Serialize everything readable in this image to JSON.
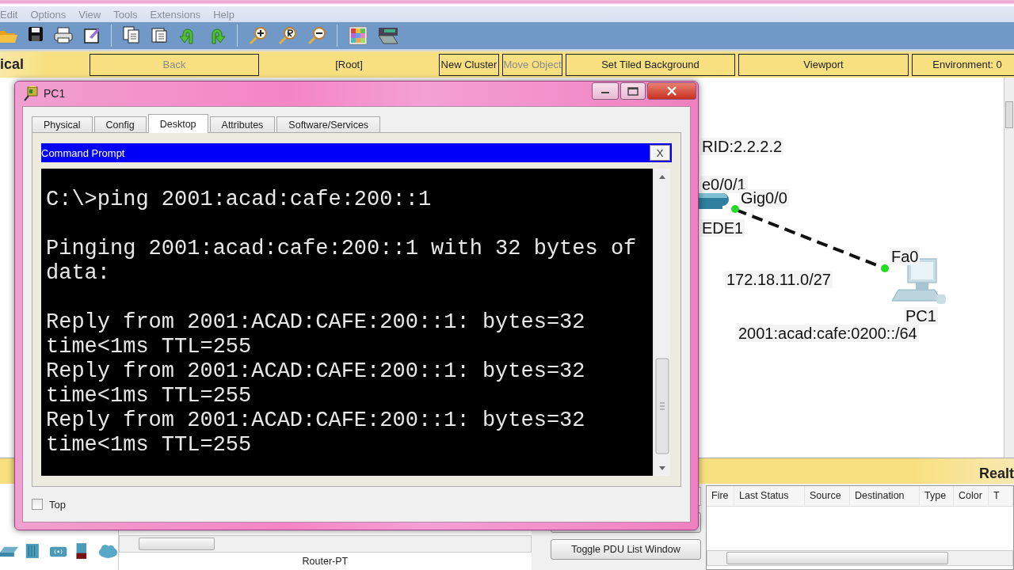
{
  "menu_bar": {
    "items": [
      "Edit",
      "Options",
      "View",
      "Tools",
      "Extensions",
      "Help"
    ]
  },
  "nav_bar": {
    "mode_label": "ical",
    "items": [
      {
        "kind": "button",
        "label": "Back",
        "disabled": true
      },
      {
        "kind": "label",
        "label": "[Root]",
        "disabled": false
      },
      {
        "kind": "button",
        "label": "New Cluster",
        "disabled": false
      },
      {
        "kind": "button",
        "label": "Move Object",
        "disabled": true
      },
      {
        "kind": "button",
        "label": "Set Tiled Background",
        "disabled": false
      },
      {
        "kind": "button",
        "label": "Viewport",
        "disabled": false
      },
      {
        "kind": "button",
        "label": "Environment: 0",
        "disabled": false
      }
    ]
  },
  "topology": {
    "labels": [
      "RID:2.2.2.2",
      "e0/0/1",
      "Gig0/0",
      "EDE1",
      "Fa0",
      "172.18.11.0/27",
      "PC1",
      "2001:acad:cafe:0200::/64"
    ]
  },
  "pc1_window": {
    "title": "PC1",
    "tabs": [
      {
        "label": "Physical",
        "selected": false
      },
      {
        "label": "Config",
        "selected": false
      },
      {
        "label": "Desktop",
        "selected": true
      },
      {
        "label": "Attributes",
        "selected": false
      },
      {
        "label": "Software/Services",
        "selected": false
      }
    ],
    "app": {
      "title": "Command Prompt",
      "close": "X",
      "lines": [
        {
          "text": "C:\\>ping 2001:acad:cafe:200::1",
          "gap_before": false
        },
        {
          "text": "Pinging 2001:acad:cafe:200::1 with 32 bytes of",
          "gap_before": true
        },
        {
          "text": "data:",
          "gap_before": false
        },
        {
          "text": "Reply from 2001:ACAD:CAFE:200::1: bytes=32",
          "gap_before": true
        },
        {
          "text": "time<1ms TTL=255",
          "gap_before": false
        },
        {
          "text": "Reply from 2001:ACAD:CAFE:200::1: bytes=32",
          "gap_before": false
        },
        {
          "text": "time<1ms TTL=255",
          "gap_before": false
        },
        {
          "text": "Reply from 2001:ACAD:CAFE:200::1: bytes=32",
          "gap_before": false
        },
        {
          "text": "time<1ms TTL=255",
          "gap_before": false
        }
      ]
    },
    "top_checkbox": {
      "label": "Top",
      "checked": false
    }
  },
  "bottom": {
    "realtime_label": "Realt",
    "device_label": "Router-PT",
    "buttons": [
      "Toggle PDU List Window"
    ],
    "pdu_table": {
      "columns": [
        "Fire",
        "Last Status",
        "Source",
        "Destination",
        "Type",
        "Color",
        "T"
      ]
    }
  }
}
